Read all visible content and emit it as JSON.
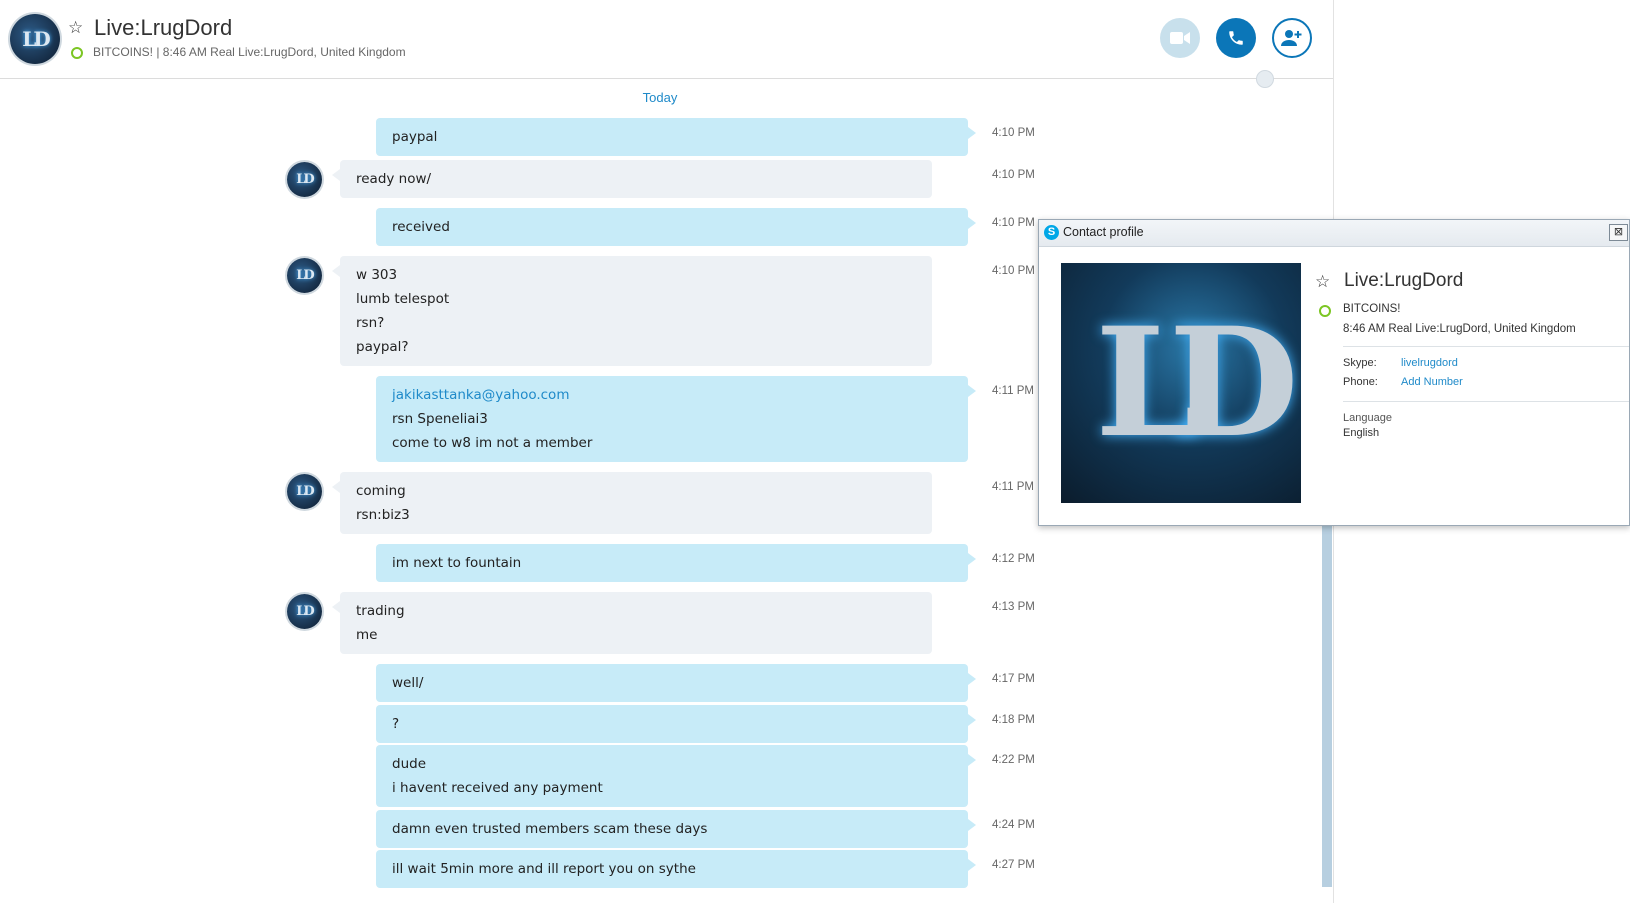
{
  "header": {
    "title": "Live:LrugDord",
    "status": "BITCOINS!  |  8:46 AM Real Live:LrugDord, United Kingdom",
    "avatar_monogram": "LD",
    "icons": [
      "star-icon",
      "video-icon",
      "phone-icon",
      "add-contact-icon",
      "globe-icon"
    ]
  },
  "chat": {
    "date_separator": "Today",
    "messages": [
      {
        "dir": "out",
        "lines": [
          "paypal"
        ],
        "time": "4:10 PM"
      },
      {
        "dir": "in",
        "lines": [
          "ready now/"
        ],
        "time": "4:10 PM"
      },
      {
        "dir": "out",
        "lines": [
          "received"
        ],
        "time": "4:10 PM"
      },
      {
        "dir": "in",
        "lines": [
          "w 303",
          "lumb telespot",
          "rsn?",
          "paypal?"
        ],
        "time": "4:10 PM"
      },
      {
        "dir": "out",
        "lines": [
          "jakikasttanka@yahoo.com",
          "rsn Speneliai3",
          "come to w8 im not a member"
        ],
        "time": "4:11 PM"
      },
      {
        "dir": "in",
        "lines": [
          "coming",
          "rsn:biz3"
        ],
        "time": "4:11 PM"
      },
      {
        "dir": "out",
        "lines": [
          "im next to fountain"
        ],
        "time": "4:12 PM"
      },
      {
        "dir": "in",
        "lines": [
          "trading",
          "me"
        ],
        "time": "4:13 PM"
      },
      {
        "dir": "out",
        "lines": [
          "well/"
        ],
        "time": "4:17 PM"
      },
      {
        "dir": "out",
        "lines": [
          "?"
        ],
        "time": "4:18 PM"
      },
      {
        "dir": "out",
        "lines": [
          "dude",
          "i havent received any payment"
        ],
        "time": "4:22 PM"
      },
      {
        "dir": "out",
        "lines": [
          "damn even trusted members scam these days"
        ],
        "time": "4:24 PM"
      },
      {
        "dir": "out",
        "lines": [
          "ill wait 5min more and ill report you on sythe"
        ],
        "time": "4:27 PM"
      }
    ]
  },
  "profile": {
    "window_title": "Contact profile",
    "close_glyph": "⊠",
    "name": "Live:LrugDord",
    "mood": "BITCOINS!",
    "local_time": "8:46 AM Real Live:LrugDord, United Kingdom",
    "skype_label": "Skype:",
    "skype_value": "livelrugdord",
    "phone_label": "Phone:",
    "phone_value": "Add Number",
    "language_label": "Language",
    "language_value": "English",
    "picture_monogram": "LD"
  },
  "colors": {
    "accent": "#0b76b8",
    "link": "#1f8ac9",
    "outgoing_bubble": "#c7ebf8",
    "incoming_bubble": "#edf1f5",
    "online": "#7cc623"
  }
}
